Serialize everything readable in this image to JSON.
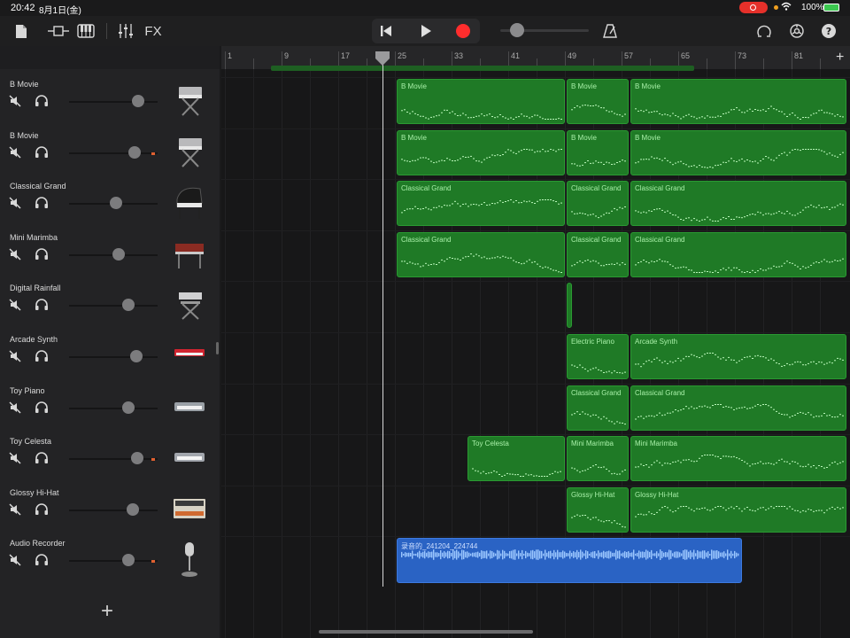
{
  "status_bar": {
    "time": "20:42",
    "date": "8月1日(金)",
    "battery": "100%"
  },
  "toolbar": {
    "fx_label": "FX"
  },
  "ruler": {
    "bars": [
      "1",
      "9",
      "17",
      "25",
      "33",
      "41",
      "49",
      "57",
      "65",
      "73",
      "81"
    ]
  },
  "tracks": [
    {
      "name": "B Movie",
      "instrument_icon": "keyboard-stand-icon",
      "fader": 0.78,
      "level": false
    },
    {
      "name": "B Movie",
      "instrument_icon": "keyboard-stand-icon",
      "fader": 0.74,
      "level": true
    },
    {
      "name": "Classical Grand",
      "instrument_icon": "grand-piano-icon",
      "fader": 0.53,
      "level": false
    },
    {
      "name": "Mini Marimba",
      "instrument_icon": "marimba-icon",
      "fader": 0.56,
      "level": false
    },
    {
      "name": "Digital Rainfall",
      "instrument_icon": "synth-stand-icon",
      "fader": 0.67,
      "level": false
    },
    {
      "name": "Arcade Synth",
      "instrument_icon": "red-keyboard-icon",
      "fader": 0.76,
      "level": false
    },
    {
      "name": "Toy Piano",
      "instrument_icon": "toy-piano-icon",
      "fader": 0.67,
      "level": false
    },
    {
      "name": "Toy Celesta",
      "instrument_icon": "celesta-icon",
      "fader": 0.77,
      "level": true
    },
    {
      "name": "Glossy Hi-Hat",
      "instrument_icon": "drum-machine-icon",
      "fader": 0.72,
      "level": false
    },
    {
      "name": "Audio Recorder",
      "instrument_icon": "microphone-icon",
      "fader": 0.67,
      "level": true
    }
  ],
  "regions": [
    {
      "lane": 0,
      "start": 25,
      "end": 49,
      "label": "B Movie",
      "kind": "midi"
    },
    {
      "lane": 0,
      "start": 49,
      "end": 58,
      "label": "B Movie",
      "kind": "midi"
    },
    {
      "lane": 0,
      "start": 58,
      "end": 132,
      "label": "B Movie",
      "kind": "midi"
    },
    {
      "lane": 1,
      "start": 25,
      "end": 49,
      "label": "B Movie",
      "kind": "midi"
    },
    {
      "lane": 1,
      "start": 49,
      "end": 58,
      "label": "B Movie",
      "kind": "midi"
    },
    {
      "lane": 1,
      "start": 58,
      "end": 132,
      "label": "B Movie",
      "kind": "midi"
    },
    {
      "lane": 2,
      "start": 25,
      "end": 49,
      "label": "Classical Grand",
      "kind": "midi"
    },
    {
      "lane": 2,
      "start": 49,
      "end": 58,
      "label": "Classical Grand",
      "kind": "midi"
    },
    {
      "lane": 2,
      "start": 58,
      "end": 132,
      "label": "Classical Grand",
      "kind": "midi"
    },
    {
      "lane": 3,
      "start": 25,
      "end": 49,
      "label": "Classical Grand",
      "kind": "midi"
    },
    {
      "lane": 3,
      "start": 49,
      "end": 58,
      "label": "Classical Grand",
      "kind": "midi"
    },
    {
      "lane": 3,
      "start": 58,
      "end": 132,
      "label": "Classical Grand",
      "kind": "midi"
    },
    {
      "lane": 4,
      "start": 49,
      "end": 50,
      "label": "",
      "kind": "midi"
    },
    {
      "lane": 5,
      "start": 49,
      "end": 58,
      "label": "Electric Piano",
      "kind": "midi"
    },
    {
      "lane": 5,
      "start": 58,
      "end": 132,
      "label": "Arcade Synth",
      "kind": "midi"
    },
    {
      "lane": 6,
      "start": 49,
      "end": 58,
      "label": "Classical Grand",
      "kind": "midi"
    },
    {
      "lane": 6,
      "start": 58,
      "end": 132,
      "label": "Classical Grand",
      "kind": "midi"
    },
    {
      "lane": 7,
      "start": 35,
      "end": 49,
      "label": "Toy Celesta",
      "kind": "midi"
    },
    {
      "lane": 7,
      "start": 49,
      "end": 58,
      "label": "Mini Marimba",
      "kind": "midi"
    },
    {
      "lane": 7,
      "start": 58,
      "end": 126,
      "label": "Mini Marimba",
      "kind": "midi"
    },
    {
      "lane": 8,
      "start": 49,
      "end": 58,
      "label": "Glossy Hi-Hat",
      "kind": "midi"
    },
    {
      "lane": 8,
      "start": 58,
      "end": 125,
      "label": "Glossy Hi-Hat",
      "kind": "midi"
    },
    {
      "lane": 9,
      "start": 25,
      "end": 74,
      "label": "录音的_241204_224744",
      "kind": "audio"
    }
  ],
  "playhead_bar": 34
}
